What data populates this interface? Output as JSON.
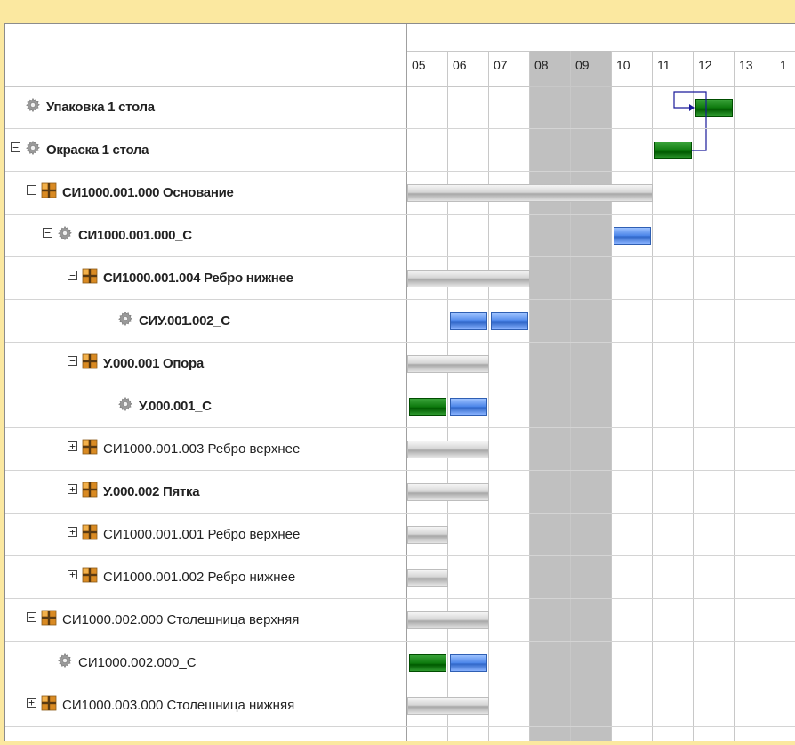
{
  "colors": {
    "frame": "#fbe8a0",
    "weekend": "#c0c0c0",
    "bar_gray": "#bdbdbd",
    "bar_blue": "#4a84e8",
    "bar_green": "#0e7a0e",
    "dependency_link": "#1a1a9a"
  },
  "timeline": {
    "days": [
      "05",
      "06",
      "07",
      "08",
      "09",
      "10",
      "11",
      "12",
      "13",
      "1"
    ],
    "weekend_days": [
      "08",
      "09"
    ]
  },
  "rows": [
    {
      "label": "Упаковка 1 стола",
      "icon": "gear-icon",
      "toggle": null,
      "bold": true,
      "level": 0,
      "bars": [
        {
          "kind": "green",
          "start": "12",
          "span": 1
        }
      ]
    },
    {
      "label": "Окраска 1 стола",
      "icon": "gear-icon",
      "toggle": "minus",
      "bold": true,
      "level": 0,
      "bars": [
        {
          "kind": "green",
          "start": "11",
          "span": 1
        }
      ]
    },
    {
      "label": "СИ1000.001.000 Основание",
      "icon": "product-icon",
      "toggle": "minus",
      "bold": true,
      "level": 1,
      "bars": [
        {
          "kind": "gray",
          "start": "05",
          "span": 6
        }
      ]
    },
    {
      "label": "СИ1000.001.000_С",
      "icon": "gear-icon",
      "toggle": "minus",
      "bold": true,
      "level": 2,
      "bars": [
        {
          "kind": "blue",
          "start": "10",
          "span": 1
        }
      ]
    },
    {
      "label": "СИ1000.001.004 Ребро нижнее",
      "icon": "product-icon",
      "toggle": "minus",
      "bold": true,
      "level": 3,
      "bars": [
        {
          "kind": "gray",
          "start": "05",
          "span": 3
        }
      ]
    },
    {
      "label": "СИУ.001.002_С",
      "icon": "gear-icon",
      "toggle": null,
      "bold": true,
      "level": 4,
      "bars": [
        {
          "kind": "blue",
          "start": "06",
          "span": 1
        },
        {
          "kind": "blue",
          "start": "07",
          "span": 1
        }
      ]
    },
    {
      "label": "У.000.001 Опора",
      "icon": "product-icon",
      "toggle": "minus",
      "bold": true,
      "level": 3,
      "bars": [
        {
          "kind": "gray",
          "start": "05",
          "span": 2
        }
      ]
    },
    {
      "label": "У.000.001_С",
      "icon": "gear-icon",
      "toggle": null,
      "bold": true,
      "level": 4,
      "bars": [
        {
          "kind": "green",
          "start": "05",
          "span": 1
        },
        {
          "kind": "blue",
          "start": "06",
          "span": 1
        }
      ]
    },
    {
      "label": "СИ1000.001.003 Ребро верхнее",
      "icon": "product-icon",
      "toggle": "plus",
      "bold": false,
      "level": 3,
      "bars": [
        {
          "kind": "gray",
          "start": "05",
          "span": 2
        }
      ]
    },
    {
      "label": "У.000.002 Пятка",
      "icon": "product-icon",
      "toggle": "plus",
      "bold": true,
      "level": 3,
      "bars": [
        {
          "kind": "gray",
          "start": "05",
          "span": 2
        }
      ]
    },
    {
      "label": "СИ1000.001.001 Ребро верхнее",
      "icon": "product-icon",
      "toggle": "plus",
      "bold": false,
      "level": 3,
      "bars": [
        {
          "kind": "gray",
          "start": "05",
          "span": 1
        }
      ]
    },
    {
      "label": "СИ1000.001.002 Ребро нижнее",
      "icon": "product-icon",
      "toggle": "plus",
      "bold": false,
      "level": 3,
      "bars": [
        {
          "kind": "gray",
          "start": "05",
          "span": 1
        }
      ]
    },
    {
      "label": "СИ1000.002.000 Столешница верхняя",
      "icon": "product-icon",
      "toggle": "minus",
      "bold": false,
      "level": 1,
      "bars": [
        {
          "kind": "gray",
          "start": "05",
          "span": 2
        }
      ]
    },
    {
      "label": "СИ1000.002.000_С",
      "icon": "gear-icon",
      "toggle": null,
      "bold": false,
      "level": 2,
      "bars": [
        {
          "kind": "green",
          "start": "05",
          "span": 1
        },
        {
          "kind": "blue",
          "start": "06",
          "span": 1
        }
      ]
    },
    {
      "label": "СИ1000.003.000 Столешница нижняя",
      "icon": "product-icon",
      "toggle": "plus",
      "bold": false,
      "level": 1,
      "bars": [
        {
          "kind": "gray",
          "start": "05",
          "span": 2
        }
      ]
    }
  ]
}
